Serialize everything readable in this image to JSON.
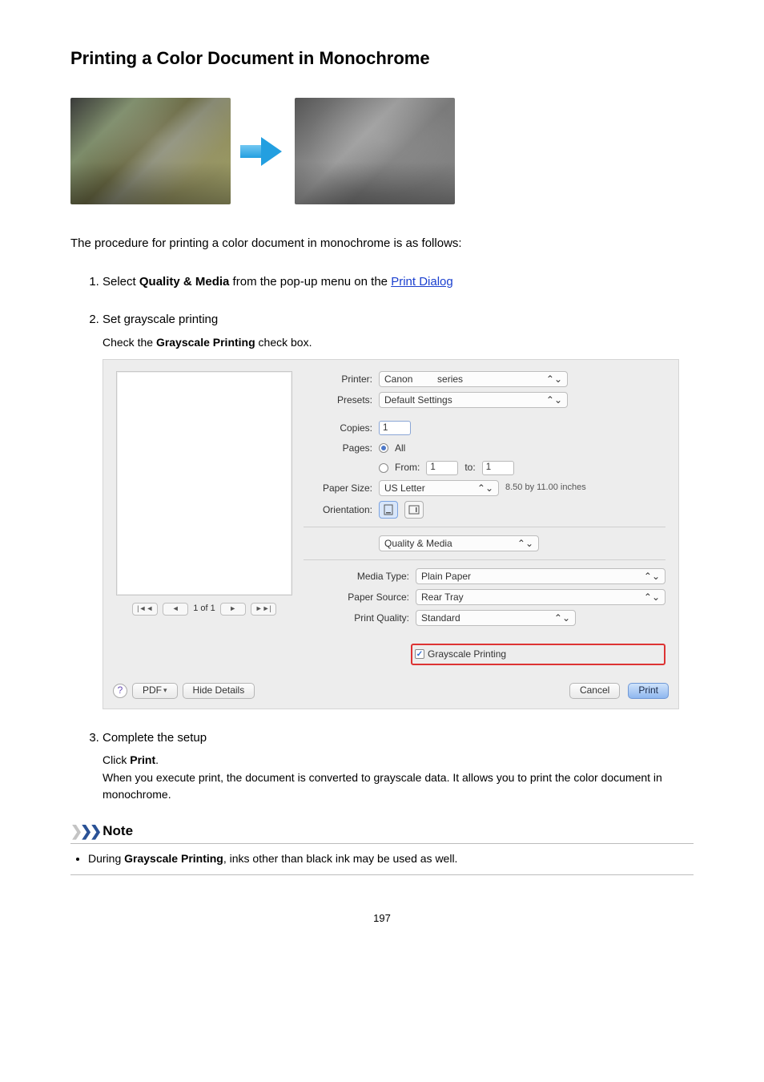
{
  "title": "Printing a Color Document in Monochrome",
  "intro": "The procedure for printing a color document in monochrome is as follows:",
  "steps": {
    "s1": {
      "prefix": "Select ",
      "bold": "Quality & Media",
      "mid": " from the pop-up menu on the ",
      "link": "Print Dialog"
    },
    "s2": {
      "title": "Set grayscale printing",
      "body_prefix": "Check the ",
      "body_bold": "Grayscale Printing",
      "body_suffix": " check box."
    },
    "s3": {
      "title": "Complete the setup",
      "body_click_prefix": "Click ",
      "body_click_bold": "Print",
      "body_click_suffix": ".",
      "body_para": "When you execute print, the document is converted to grayscale data. It allows you to print the color document in monochrome."
    }
  },
  "dialog": {
    "printer_label": "Printer:",
    "printer_value": "Canon    series",
    "presets_label": "Presets:",
    "presets_value": "Default Settings",
    "copies_label": "Copies:",
    "copies_value": "1",
    "pages_label": "Pages:",
    "pages_all": "All",
    "pages_from": "From:",
    "pages_from_v": "1",
    "pages_to": "to:",
    "pages_to_v": "1",
    "paper_size_label": "Paper Size:",
    "paper_size_value": "US Letter",
    "paper_size_info": "8.50 by 11.00 inches",
    "orientation_label": "Orientation:",
    "panel_value": "Quality & Media",
    "media_type_label": "Media Type:",
    "media_type_value": "Plain Paper",
    "paper_source_label": "Paper Source:",
    "paper_source_value": "Rear Tray",
    "print_quality_label": "Print Quality:",
    "print_quality_value": "Standard",
    "grayscale_label": "Grayscale Printing",
    "nav_pages": "1 of 1",
    "help": "?",
    "pdf": "PDF",
    "hide_details": "Hide Details",
    "cancel": "Cancel",
    "print_btn": "Print"
  },
  "note": {
    "heading": "Note",
    "item_prefix": "During ",
    "item_bold": "Grayscale Printing",
    "item_suffix": ", inks other than black ink may be used as well."
  },
  "page_number": "197"
}
